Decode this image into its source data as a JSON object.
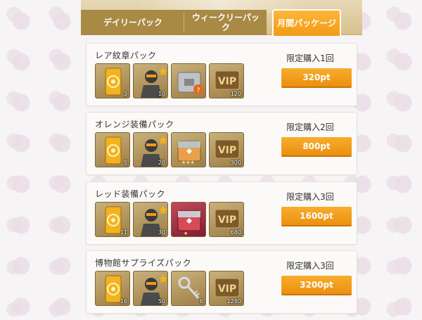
{
  "tabs": {
    "daily": "デイリーパック",
    "weekly": "ウィークリーパック",
    "monthly": "月間パッケージ"
  },
  "colors": {
    "accent": "#f29b14",
    "tab_inactive": "#a98a45",
    "card_bg": "#fbfaf8"
  },
  "packs": [
    {
      "title": "レア紋章パック",
      "limit": "限定購入1回",
      "price": "320pt",
      "items": [
        {
          "icon": "gold-ticket-icon",
          "qty": "3"
        },
        {
          "icon": "robot-character-icon",
          "qty": "10"
        },
        {
          "icon": "gray-crate-icon",
          "qty": ""
        },
        {
          "icon": "vip-card-icon",
          "qty": "120"
        }
      ]
    },
    {
      "title": "オレンジ装備パック",
      "limit": "限定購入2回",
      "price": "800pt",
      "items": [
        {
          "icon": "gold-ticket-icon",
          "qty": "5"
        },
        {
          "icon": "robot-character-icon",
          "qty": "20"
        },
        {
          "icon": "orange-crate-icon",
          "qty": ""
        },
        {
          "icon": "vip-card-icon",
          "qty": "300"
        }
      ]
    },
    {
      "title": "レッド装備パック",
      "limit": "限定購入3回",
      "price": "1600pt",
      "items": [
        {
          "icon": "gold-ticket-icon",
          "qty": "11"
        },
        {
          "icon": "robot-character-icon",
          "qty": "30"
        },
        {
          "icon": "red-crate-icon",
          "qty": ""
        },
        {
          "icon": "vip-card-icon",
          "qty": "680"
        }
      ]
    },
    {
      "title": "博物館サプライズパック",
      "limit": "限定購入3回",
      "price": "3200pt",
      "items": [
        {
          "icon": "gold-ticket-icon",
          "qty": "16"
        },
        {
          "icon": "robot-character-icon",
          "qty": "50"
        },
        {
          "icon": "key-icon",
          "qty": "6"
        },
        {
          "icon": "vip-card-icon",
          "qty": "1280"
        }
      ]
    }
  ]
}
